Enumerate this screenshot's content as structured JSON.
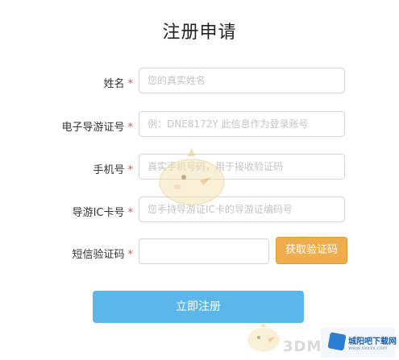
{
  "form": {
    "title": "注册申请",
    "required_mark": "*",
    "fields": [
      {
        "label": "姓名",
        "placeholder": "您的真实姓名"
      },
      {
        "label": "电子导游证号",
        "placeholder": "例：DNE8172Y  此信息作为登录账号"
      },
      {
        "label": "手机号",
        "placeholder": "真实手机号码，用于接收验证码"
      },
      {
        "label": "导游IC卡号",
        "placeholder": "您手持导游证IC卡的导游证编码号"
      },
      {
        "label": "短信验证码",
        "placeholder": ""
      }
    ],
    "get_code_button": "获取验证码",
    "submit_button": "立即注册"
  },
  "watermark": {
    "brand_name": "城阳吧下载网",
    "brand_sub": "www.xxxxx.com",
    "site_3dm": "3DM"
  },
  "colors": {
    "accent_orange": "#f0ad4e",
    "submit_blue": "#5bb7ea",
    "required_red": "#d9534f"
  }
}
